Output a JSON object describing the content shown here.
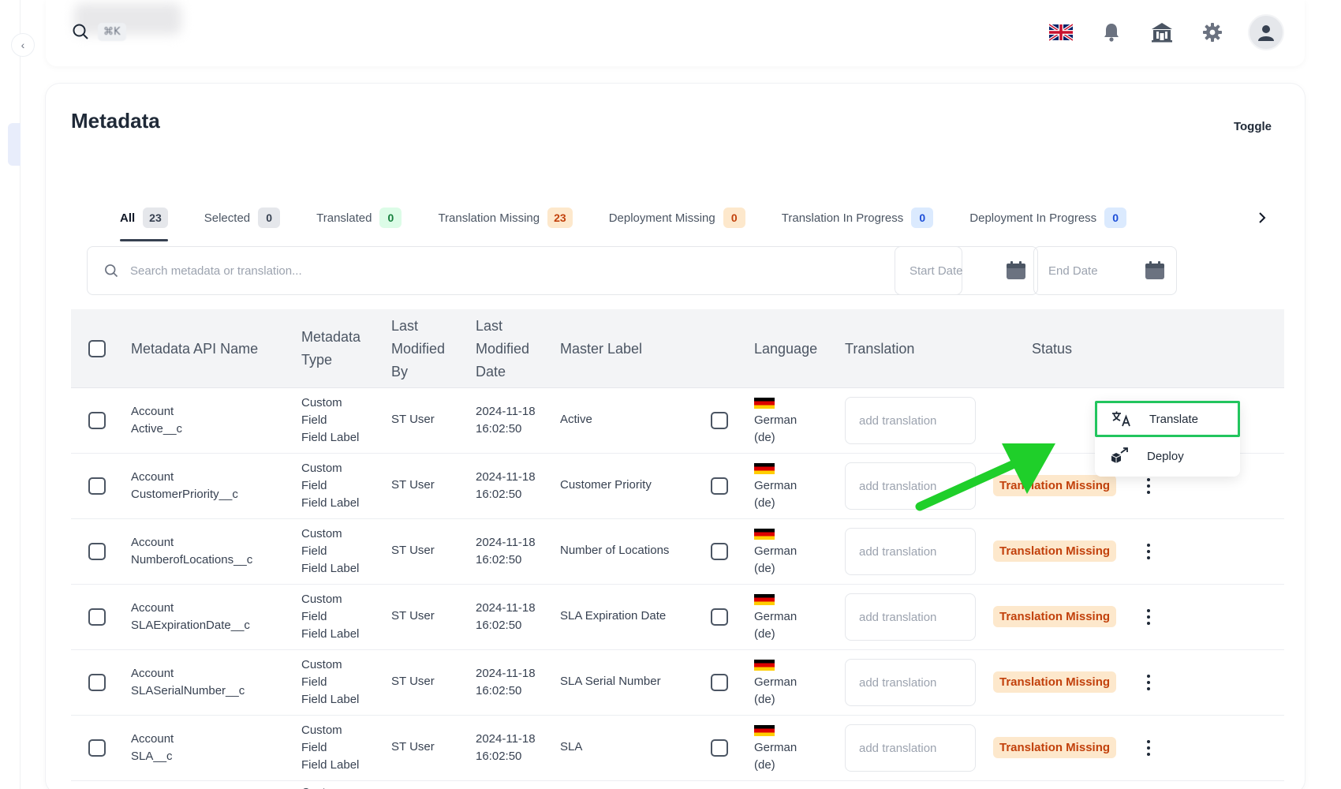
{
  "topbar": {
    "search_shortcut": "⌘K",
    "icons": [
      "search-icon",
      "uk-flag-icon",
      "bell-icon",
      "bank-icon",
      "gear-icon",
      "user-icon"
    ]
  },
  "page": {
    "title": "Metadata",
    "toggle_label": "Toggle"
  },
  "tabs": [
    {
      "label": "All",
      "count": "23"
    },
    {
      "label": "Selected",
      "count": "0"
    },
    {
      "label": "Translated",
      "count": "0"
    },
    {
      "label": "Translation Missing",
      "count": "23"
    },
    {
      "label": "Deployment Missing",
      "count": "0"
    },
    {
      "label": "Translation In Progress",
      "count": "0"
    },
    {
      "label": "Deployment In Progress",
      "count": "0"
    }
  ],
  "filters": {
    "search_placeholder": "Search metadata or translation...",
    "start_date_placeholder": "Start Date",
    "end_date_placeholder": "End Date"
  },
  "table": {
    "headers": {
      "api_name": "Metadata API Name",
      "type": "Metadata Type",
      "modified_by": "Last Modified By",
      "modified_date": "Last Modified Date",
      "master_label": "Master Label",
      "language": "Language",
      "translation": "Translation",
      "status": "Status"
    },
    "rows": [
      {
        "api1": "Account",
        "api2": "Active__c",
        "t1": "Custom",
        "t2": "Field",
        "t3": "Field Label",
        "by": "ST User",
        "d1": "2024-11-18",
        "d2": "16:02:50",
        "label": "Active",
        "lang1": "German",
        "lang2": "(de)",
        "translation_placeholder": "add translation",
        "status": ""
      },
      {
        "api1": "Account",
        "api2": "CustomerPriority__c",
        "t1": "Custom",
        "t2": "Field",
        "t3": "Field Label",
        "by": "ST User",
        "d1": "2024-11-18",
        "d2": "16:02:50",
        "label": "Customer Priority",
        "lang1": "German",
        "lang2": "(de)",
        "translation_placeholder": "add translation",
        "status": "Translation Missing"
      },
      {
        "api1": "Account",
        "api2": "NumberofLocations__c",
        "t1": "Custom",
        "t2": "Field",
        "t3": "Field Label",
        "by": "ST User",
        "d1": "2024-11-18",
        "d2": "16:02:50",
        "label": "Number of Locations",
        "lang1": "German",
        "lang2": "(de)",
        "translation_placeholder": "add translation",
        "status": "Translation Missing"
      },
      {
        "api1": "Account",
        "api2": "SLAExpirationDate__c",
        "t1": "Custom",
        "t2": "Field",
        "t3": "Field Label",
        "by": "ST User",
        "d1": "2024-11-18",
        "d2": "16:02:50",
        "label": "SLA Expiration Date",
        "lang1": "German",
        "lang2": "(de)",
        "translation_placeholder": "add translation",
        "status": "Translation Missing"
      },
      {
        "api1": "Account",
        "api2": "SLASerialNumber__c",
        "t1": "Custom",
        "t2": "Field",
        "t3": "Field Label",
        "by": "ST User",
        "d1": "2024-11-18",
        "d2": "16:02:50",
        "label": "SLA Serial Number",
        "lang1": "German",
        "lang2": "(de)",
        "translation_placeholder": "add translation",
        "status": "Translation Missing"
      },
      {
        "api1": "Account",
        "api2": "SLA__c",
        "t1": "Custom",
        "t2": "Field",
        "t3": "Field Label",
        "by": "ST User",
        "d1": "2024-11-18",
        "d2": "16:02:50",
        "label": "SLA",
        "lang1": "German",
        "lang2": "(de)",
        "translation_placeholder": "add translation",
        "status": "Translation Missing"
      }
    ],
    "partial_row_type": "Custom"
  },
  "row_menu": {
    "translate_label": "Translate",
    "deploy_label": "Deploy"
  },
  "colors": {
    "highlight": "#22c55e",
    "arrow": "#1fcf2a",
    "status_missing_bg": "#fde8cc",
    "status_missing_text": "#c2410c"
  }
}
